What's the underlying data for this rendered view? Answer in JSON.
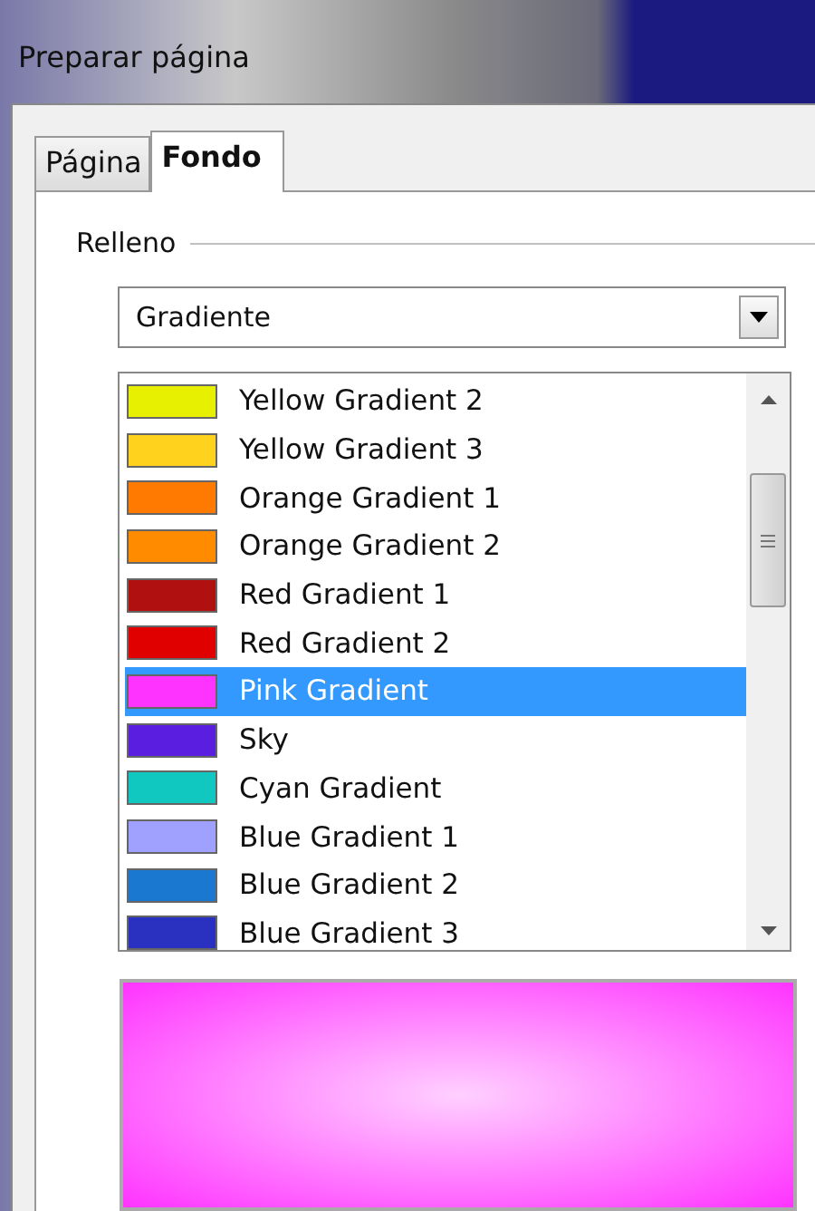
{
  "window": {
    "title": "Preparar página"
  },
  "tabs": [
    {
      "label": "Página",
      "selected": false
    },
    {
      "label": "Fondo",
      "selected": true
    }
  ],
  "fill": {
    "label": "Relleno",
    "dropdown": {
      "value": "Gradiente"
    }
  },
  "gradients": [
    {
      "name": "Yellow Gradient 2",
      "color": "#e6f000",
      "selected": false
    },
    {
      "name": "Yellow Gradient 3",
      "color": "#ffd21e",
      "selected": false
    },
    {
      "name": "Orange Gradient 1",
      "color": "#ff7a00",
      "selected": false
    },
    {
      "name": "Orange Gradient 2",
      "color": "#ff8c00",
      "selected": false
    },
    {
      "name": "Red Gradient 1",
      "color": "#b01010",
      "selected": false
    },
    {
      "name": "Red Gradient 2",
      "color": "#e00000",
      "selected": false
    },
    {
      "name": "Pink Gradient",
      "color": "#ff33ff",
      "selected": true
    },
    {
      "name": "Sky",
      "color": "#5a1ee0",
      "selected": false
    },
    {
      "name": "Cyan Gradient",
      "color": "#10c8c0",
      "selected": false
    },
    {
      "name": "Blue Gradient 1",
      "color": "#a0a0ff",
      "selected": false
    },
    {
      "name": "Blue Gradient 2",
      "color": "#1a78d0",
      "selected": false
    },
    {
      "name": "Blue Gradient 3",
      "color": "#2a30c0",
      "selected": false
    }
  ]
}
